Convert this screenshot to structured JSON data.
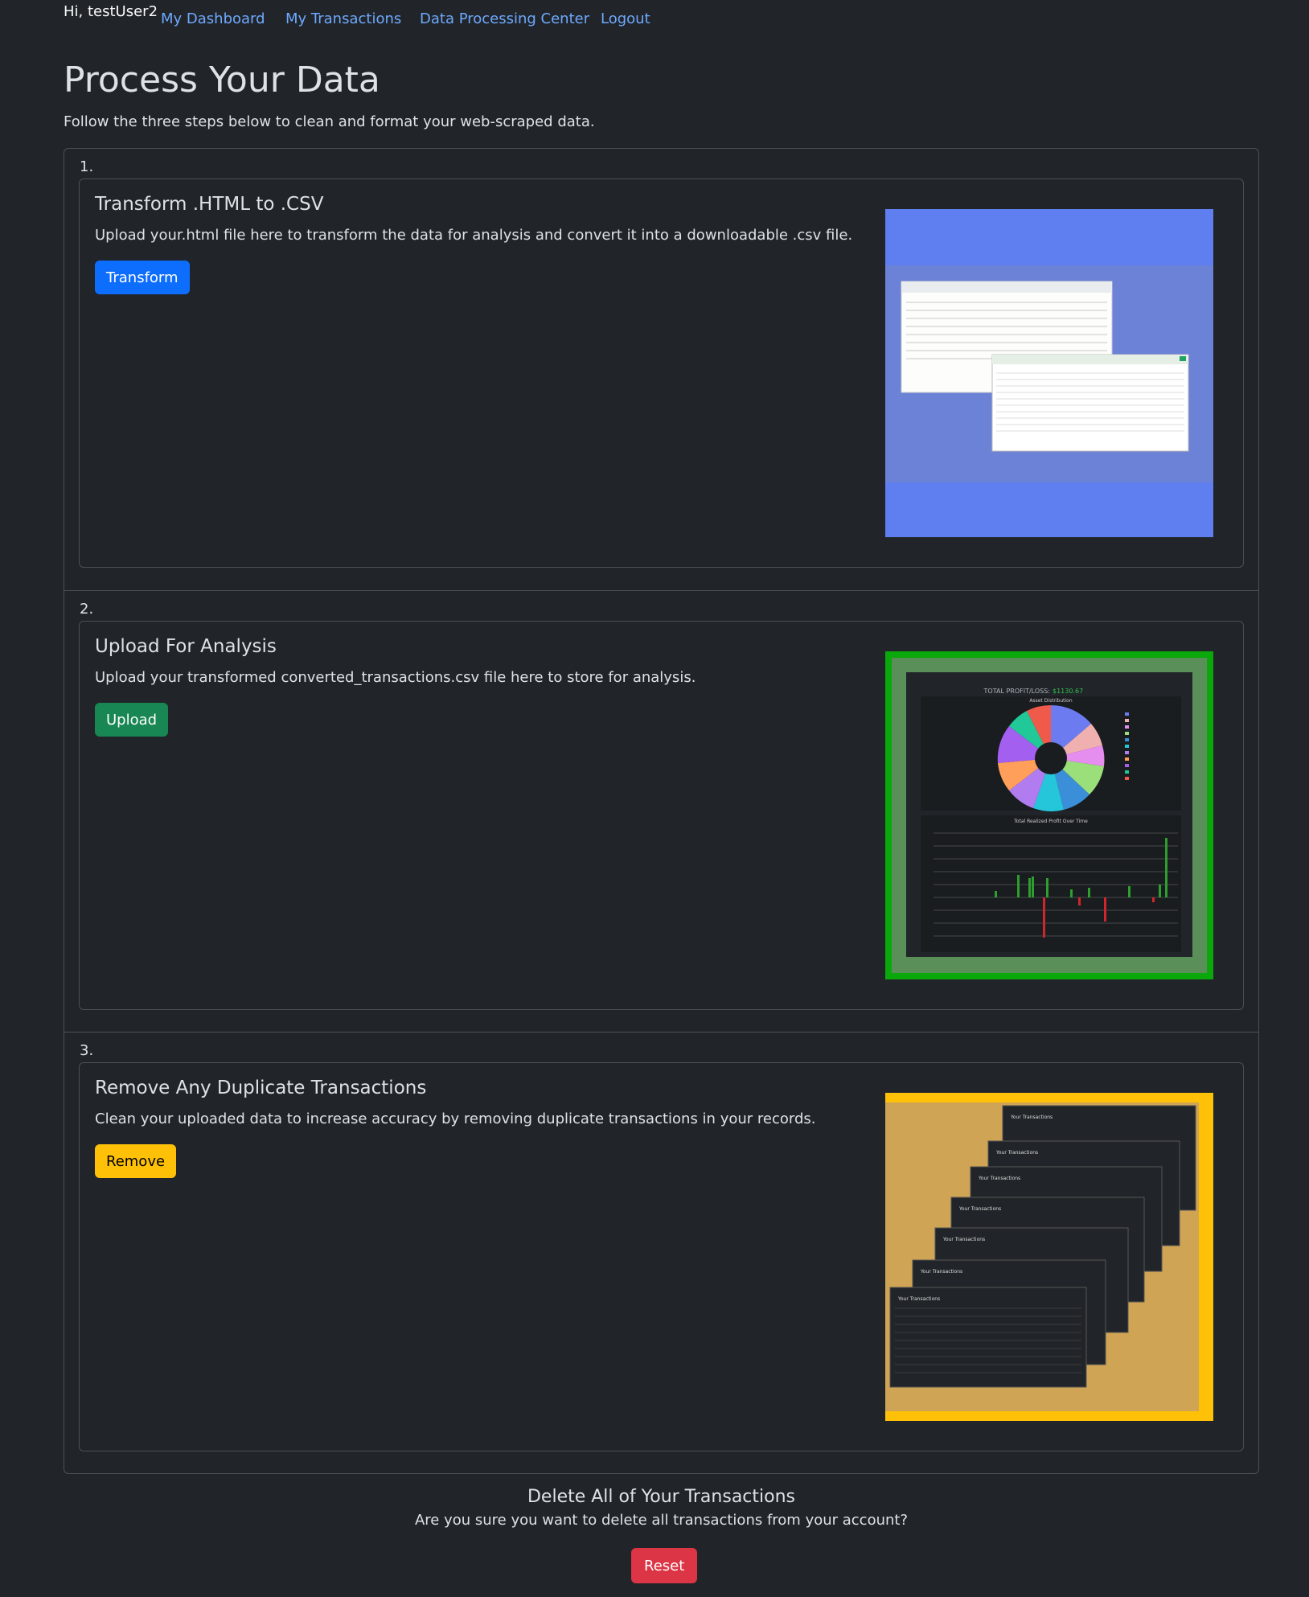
{
  "nav": {
    "greeting": "Hi, testUser2",
    "links": [
      "My Dashboard",
      "My Transactions",
      "Data Processing Center",
      "Logout"
    ]
  },
  "page": {
    "title": "Process Your Data",
    "intro": "Follow the three steps below to clean and format your web-scraped data."
  },
  "steps": [
    {
      "number": "1.",
      "title": "Transform .HTML to .CSV",
      "description": "Upload your.html file here to transform the data for analysis and convert it into a downloadable .csv file.",
      "button": "Transform"
    },
    {
      "number": "2.",
      "title": "Upload For Analysis",
      "description": "Upload your transformed converted_transactions.csv file here to store for analysis.",
      "button": "Upload"
    },
    {
      "number": "3.",
      "title": "Remove Any Duplicate Transactions",
      "description": "Clean your uploaded data to increase accuracy by removing duplicate transactions in your records.",
      "button": "Remove"
    }
  ],
  "preview": {
    "profit_label": "TOTAL PROFIT/LOSS:",
    "profit_value": "$1130.67",
    "pie_title": "Asset Distribution",
    "bar_title": "Total Realized Profit Over Time",
    "tx_title": "Your Transactions"
  },
  "delete": {
    "title": "Delete All of Your Transactions",
    "question": "Are you sure you want to delete all transactions from your account?",
    "button": "Reset"
  },
  "colors": {
    "background": "#212529",
    "link": "#6ea8fe",
    "primary": "#0d6efd",
    "success": "#198754",
    "warning": "#ffc107",
    "danger": "#dc3545"
  }
}
